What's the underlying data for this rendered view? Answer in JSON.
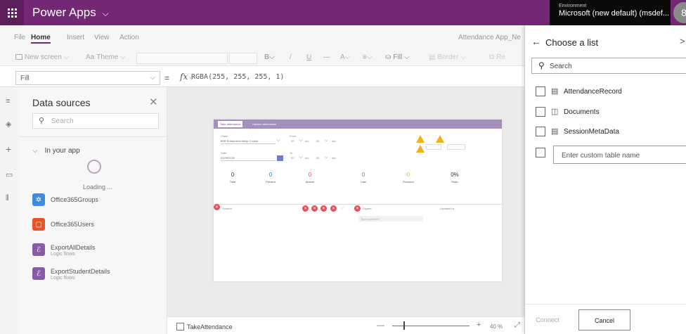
{
  "app": {
    "title": "Power Apps",
    "title_chevron": "⌵"
  },
  "environment": {
    "label": "Environment",
    "name": "Microsoft (new default) (msdef...",
    "avatar": "8"
  },
  "menu": {
    "items": [
      "File",
      "Home",
      "Insert",
      "View",
      "Action"
    ],
    "active": "Home",
    "doc_title": "Attendance App_Ne"
  },
  "toolbar": {
    "new_screen": "New screen ⌵",
    "theme": "Theme ⌵",
    "fill": "Fill ⌵",
    "border": "Border ⌵",
    "bold": "B⌵",
    "italic": "/",
    "underline": "U",
    "strike": "—",
    "font_color": "A⌵",
    "align": "≡⌵",
    "reorder": "Re"
  },
  "formula": {
    "property": "Fill",
    "equals": "=",
    "fx": "fx",
    "fx_chevron": "⌵",
    "value": "RGBA(255, 255, 255, 1)"
  },
  "rail": {
    "icons": [
      "≡",
      "◈",
      "+",
      "▭",
      "⫴"
    ]
  },
  "datasources": {
    "title": "Data sources",
    "close": "✕",
    "search_placeholder": "Search",
    "group": "In your app",
    "loading": "Loading ...",
    "items": [
      {
        "name": "Office365Groups",
        "sub": "",
        "color": "#3f8be0",
        "icon": "✲"
      },
      {
        "name": "Office365Users",
        "sub": "",
        "color": "#e8542a",
        "icon": "▢"
      },
      {
        "name": "ExportAllDetails",
        "sub": "Logic flows",
        "color": "#8a5aa6",
        "icon": "ℰ"
      },
      {
        "name": "ExportStudentDetails",
        "sub": "Logic flows",
        "color": "#8a5aa6",
        "icon": "ℰ"
      }
    ]
  },
  "preview": {
    "tab1": "Take attendance",
    "tab2": "Historic attendance",
    "class_label": "Class",
    "class_value": "B2B Entrepreneurship Course",
    "date_label": "Date",
    "date_value": "01/29/2020",
    "from_label": "From",
    "to_label": "To",
    "hrs": "hrs",
    "min": "min",
    "t00": "00",
    "stats": [
      {
        "num": "0",
        "label": "Total",
        "color": "#333"
      },
      {
        "num": "0",
        "label": "Present",
        "color": "#1f86c7"
      },
      {
        "num": "0",
        "label": "Absent",
        "color": "#e0505a"
      },
      {
        "num": "0",
        "label": "Late",
        "color": "#7a7a7a"
      },
      {
        "num": "0",
        "label": "Excused",
        "color": "#e0c33a"
      },
      {
        "num": "0%",
        "label": "Ratio",
        "color": "#333"
      }
    ],
    "row_name": "Student",
    "row_signed": "Signed",
    "row_updated": "Updated by",
    "comment_placeholder": "Type comment"
  },
  "statusbar": {
    "screen_name": "TakeAttendance",
    "zoom": "40 %",
    "minus": "—",
    "plus": "+",
    "fit": "⤢"
  },
  "panel": {
    "back": "←",
    "title": "Choose a list",
    "close": ">",
    "search_placeholder": "Search",
    "lists": [
      {
        "name": "AttendanceRecord",
        "icon": "▤"
      },
      {
        "name": "Documents",
        "icon": "◫"
      },
      {
        "name": "SessionMetaData",
        "icon": "▤"
      }
    ],
    "custom_placeholder": "Enter custom table name",
    "connect": "Connect",
    "cancel": "Cancel"
  }
}
